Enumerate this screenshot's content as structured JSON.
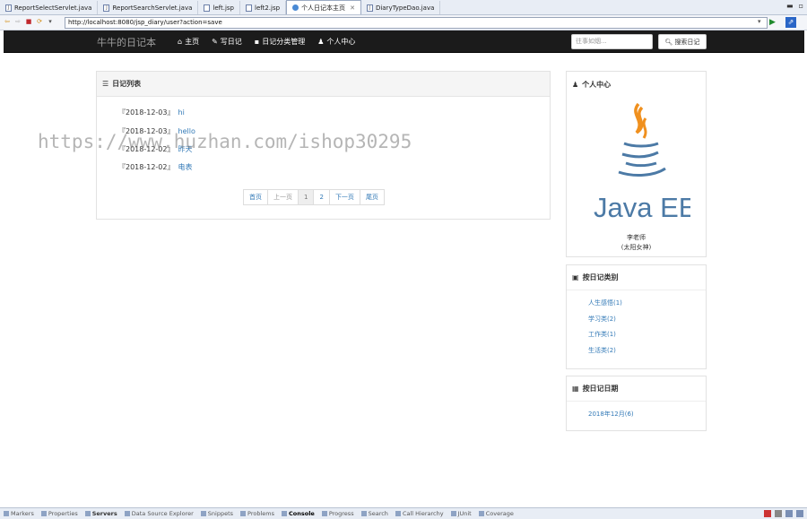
{
  "editor_tabs": [
    {
      "label": "ReportSelectServlet.java",
      "type": "java",
      "active": false
    },
    {
      "label": "ReportSearchServlet.java",
      "type": "java",
      "active": false
    },
    {
      "label": "left.jsp",
      "type": "jsp",
      "active": false
    },
    {
      "label": "left2.jsp",
      "type": "jsp",
      "active": false
    },
    {
      "label": "个人日记本主页",
      "type": "browser",
      "active": true
    },
    {
      "label": "DiaryTypeDao.java",
      "type": "java",
      "active": false
    }
  ],
  "address": {
    "url": "http://localhost:8080/jsp_diary/user?action=save"
  },
  "navbar": {
    "brand": "牛牛的日记本",
    "links": [
      {
        "icon": "home-icon",
        "glyph": "⌂",
        "label": "主页"
      },
      {
        "icon": "pencil-icon",
        "glyph": "✎",
        "label": "写日记"
      },
      {
        "icon": "book-icon",
        "glyph": "▪",
        "label": "日记分类管理"
      },
      {
        "icon": "user-icon",
        "glyph": "♟",
        "label": "个人中心"
      }
    ],
    "search_placeholder": "往事如烟...",
    "search_button": "搜索日记"
  },
  "diary_panel": {
    "title": "日记列表",
    "items": [
      {
        "date": "『2018-12-03』",
        "title": "hi"
      },
      {
        "date": "『2018-12-03』",
        "title": "hello"
      },
      {
        "date": "『2018-12-02』",
        "title": "昨天"
      },
      {
        "date": "『2018-12-02』",
        "title": "电表"
      }
    ],
    "pager": [
      "首页",
      "上一页",
      "1",
      "2",
      "下一页",
      "尾页"
    ]
  },
  "watermark": "https://www.huzhan.com/ishop30295",
  "profile_panel": {
    "title": "个人中心",
    "logo_text": "Java EE",
    "name": "李老师",
    "motto": "(太阳女神)"
  },
  "category_panel": {
    "title": "按日记类别",
    "items": [
      "人生感悟(1)",
      "学习类(2)",
      "工作类(1)",
      "生活类(2)"
    ]
  },
  "date_panel": {
    "title": "按日记日期",
    "items": [
      "2018年12月(6)"
    ]
  },
  "bottom_tabs": [
    "Markers",
    "Properties",
    "Servers",
    "Data Source Explorer",
    "Snippets",
    "Problems",
    "Console",
    "Progress",
    "Search",
    "Call Hierarchy",
    "JUnit",
    "Coverage"
  ],
  "colors": {
    "navbar_bg": "#1b1b1b",
    "link": "#337ab7",
    "java_orange": "#f0901e",
    "java_blue": "#4c7aa6"
  }
}
